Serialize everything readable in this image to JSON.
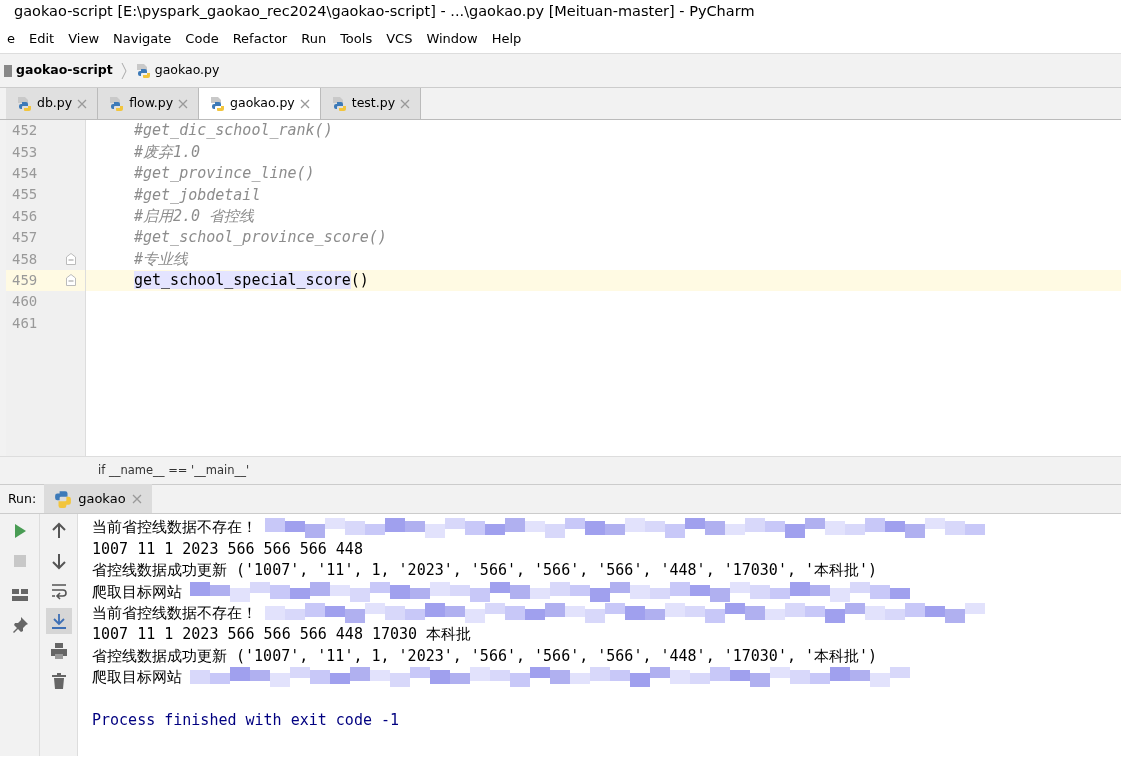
{
  "window": {
    "title": "gaokao-script [E:\\pyspark_gaokao_rec2024\\gaokao-script] - ...\\gaokao.py [Meituan-master] - PyCharm"
  },
  "menu": [
    {
      "label": "e"
    },
    {
      "label": "Edit"
    },
    {
      "label": "View"
    },
    {
      "label": "Navigate"
    },
    {
      "label": "Code"
    },
    {
      "label": "Refactor"
    },
    {
      "label": "Run"
    },
    {
      "label": "Tools"
    },
    {
      "label": "VCS"
    },
    {
      "label": "Window"
    },
    {
      "label": "Help"
    }
  ],
  "breadcrumb": [
    {
      "label": "gaokao-script",
      "kind": "folder"
    },
    {
      "label": "gaokao.py",
      "kind": "file"
    }
  ],
  "tabs": [
    {
      "label": "db.py",
      "selected": false
    },
    {
      "label": "flow.py",
      "selected": false
    },
    {
      "label": "gaokao.py",
      "selected": true
    },
    {
      "label": "test.py",
      "selected": false
    }
  ],
  "editor": {
    "lines": [
      {
        "number": "452",
        "kind": "comment",
        "text": "#get_dic_school_rank()",
        "current": false,
        "fold": false
      },
      {
        "number": "453",
        "kind": "comment",
        "text": "#废弃1.0",
        "current": false,
        "fold": false
      },
      {
        "number": "454",
        "kind": "comment",
        "text": "#get_province_line()",
        "current": false,
        "fold": false
      },
      {
        "number": "455",
        "kind": "comment",
        "text": "#get_jobdetail",
        "current": false,
        "fold": false
      },
      {
        "number": "456",
        "kind": "comment",
        "text": "#启用2.0 省控线",
        "current": false,
        "fold": false
      },
      {
        "number": "457",
        "kind": "comment",
        "text": "#get_school_province_score()",
        "current": false,
        "fold": false
      },
      {
        "number": "458",
        "kind": "comment",
        "text": "#专业线",
        "current": false,
        "fold": true
      },
      {
        "number": "459",
        "kind": "code",
        "selected_text": "get_school_special_score",
        "text": "()",
        "current": true,
        "fold": true
      },
      {
        "number": "460",
        "current": false,
        "fold": false
      },
      {
        "number": "461",
        "current": false,
        "fold": false
      }
    ],
    "context": "if __name__ == '__main__'"
  },
  "run": {
    "label": "Run:",
    "tabs": [
      {
        "label": "gaokao",
        "selected": true
      }
    ],
    "console": [
      {
        "kind": "output",
        "text": "当前省控线数据不存在！",
        "redacted": true
      },
      {
        "kind": "output",
        "text": "1007 11 1 2023 566 566 566 448",
        "redacted": false
      },
      {
        "kind": "output",
        "text": "省控线数据成功更新 ('1007', '11', 1, '2023', '566', '566', '566', '448', '17030', '本科批')",
        "redacted": false
      },
      {
        "kind": "output",
        "text": "爬取目标网站",
        "redacted": true
      },
      {
        "kind": "output",
        "text": "当前省控线数据不存在！",
        "redacted": true
      },
      {
        "kind": "output",
        "text": "1007 11 1 2023 566 566 566 448 17030 本科批",
        "redacted": false
      },
      {
        "kind": "output",
        "text": "省控线数据成功更新 ('1007', '11', 1, '2023', '566', '566', '566', '448', '17030', '本科批')",
        "redacted": false
      },
      {
        "kind": "output",
        "text": "爬取目标网站",
        "redacted": true
      },
      {
        "kind": "blank"
      },
      {
        "kind": "exit",
        "text": "Process finished with exit code -1",
        "redacted": false
      }
    ]
  }
}
